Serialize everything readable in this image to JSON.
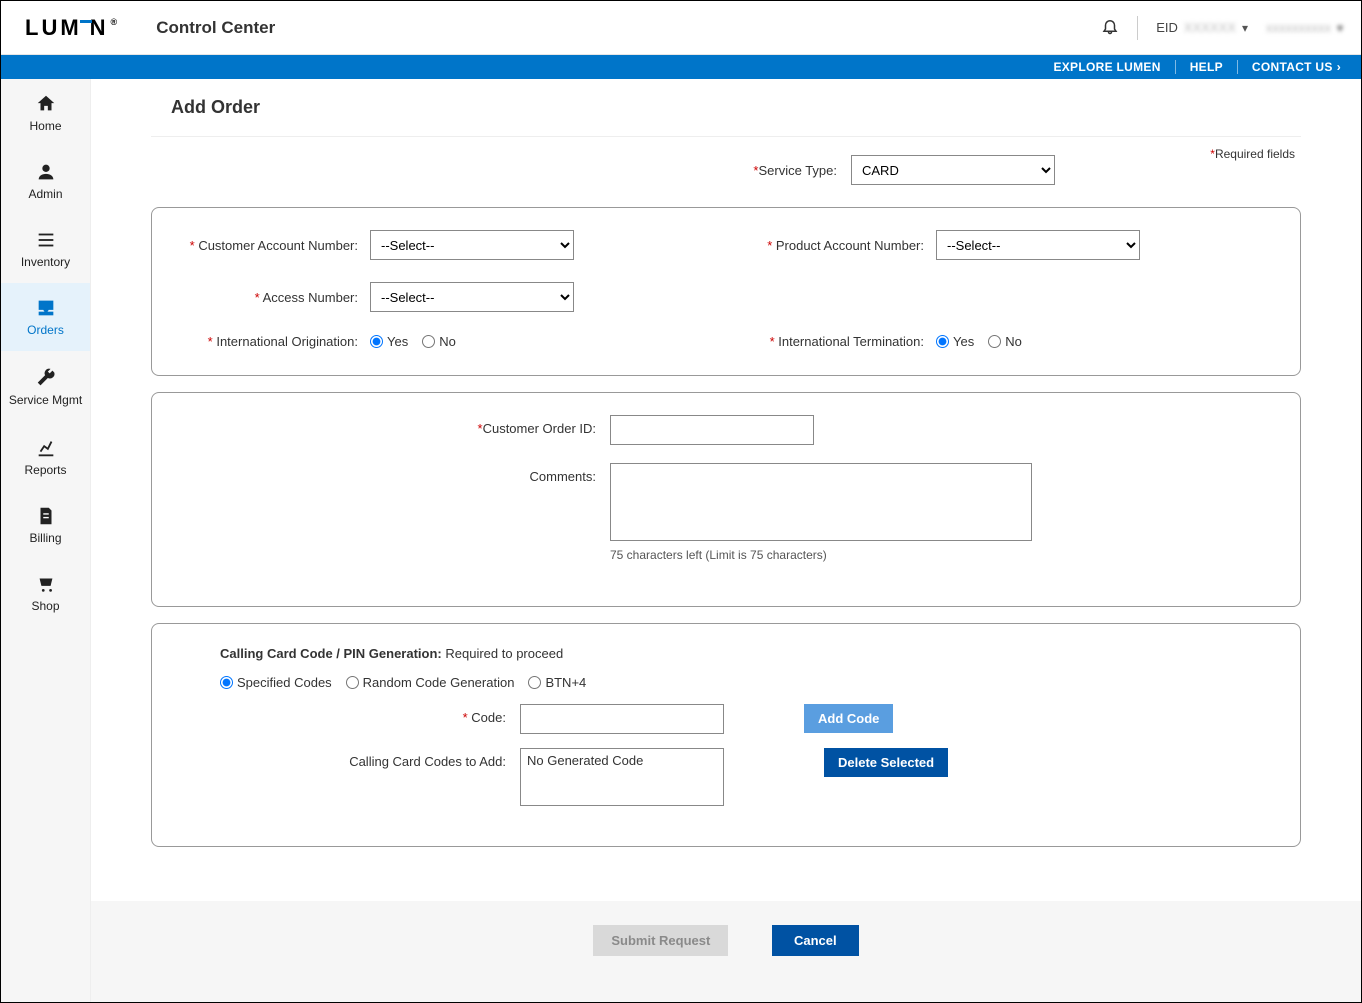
{
  "header": {
    "logo_text": "LUM  N",
    "app_title": "Control Center",
    "eid_prefix": "EID",
    "eid_value": "XXXXXX",
    "username": "xxxxxxxxxx"
  },
  "bluestrip": {
    "explore": "EXPLORE LUMEN",
    "help": "HELP",
    "contact": "CONTACT US"
  },
  "sidebar": {
    "items": [
      {
        "key": "home",
        "label": "Home"
      },
      {
        "key": "admin",
        "label": "Admin"
      },
      {
        "key": "inventory",
        "label": "Inventory"
      },
      {
        "key": "orders",
        "label": "Orders"
      },
      {
        "key": "service-mgmt",
        "label": "Service Mgmt"
      },
      {
        "key": "reports",
        "label": "Reports"
      },
      {
        "key": "billing",
        "label": "Billing"
      },
      {
        "key": "shop",
        "label": "Shop"
      }
    ],
    "active_key": "orders"
  },
  "page": {
    "title": "Add Order",
    "required_note": "Required fields"
  },
  "service_type": {
    "label": "Service Type:",
    "value": "CARD"
  },
  "account_panel": {
    "customer_account_label": "Customer Account Number:",
    "customer_account_value": "--Select--",
    "product_account_label": "Product Account Number:",
    "product_account_value": "--Select--",
    "access_number_label": "Access Number:",
    "access_number_value": "--Select--",
    "intl_orig_label": "International Origination:",
    "intl_orig_yes": "Yes",
    "intl_orig_no": "No",
    "intl_orig_value": "Yes",
    "intl_term_label": "International Termination:",
    "intl_term_yes": "Yes",
    "intl_term_no": "No",
    "intl_term_value": "Yes"
  },
  "order_panel": {
    "customer_order_id_label": "Customer Order ID:",
    "customer_order_id_value": "",
    "comments_label": "Comments:",
    "comments_value": "",
    "comments_hint": "75 characters left (Limit is 75 characters)"
  },
  "pin_panel": {
    "title": "Calling Card Code / PIN Generation:",
    "subtitle": "Required to proceed",
    "opt_specified": "Specified Codes",
    "opt_random": "Random Code Generation",
    "opt_btn4": "BTN+4",
    "selected_option": "Specified Codes",
    "code_label": "Code:",
    "code_value": "",
    "add_code_btn": "Add Code",
    "codes_to_add_label": "Calling Card Codes to Add:",
    "codes_list_placeholder": "No Generated Code",
    "delete_selected_btn": "Delete Selected"
  },
  "footer": {
    "submit": "Submit Request",
    "cancel": "Cancel"
  }
}
